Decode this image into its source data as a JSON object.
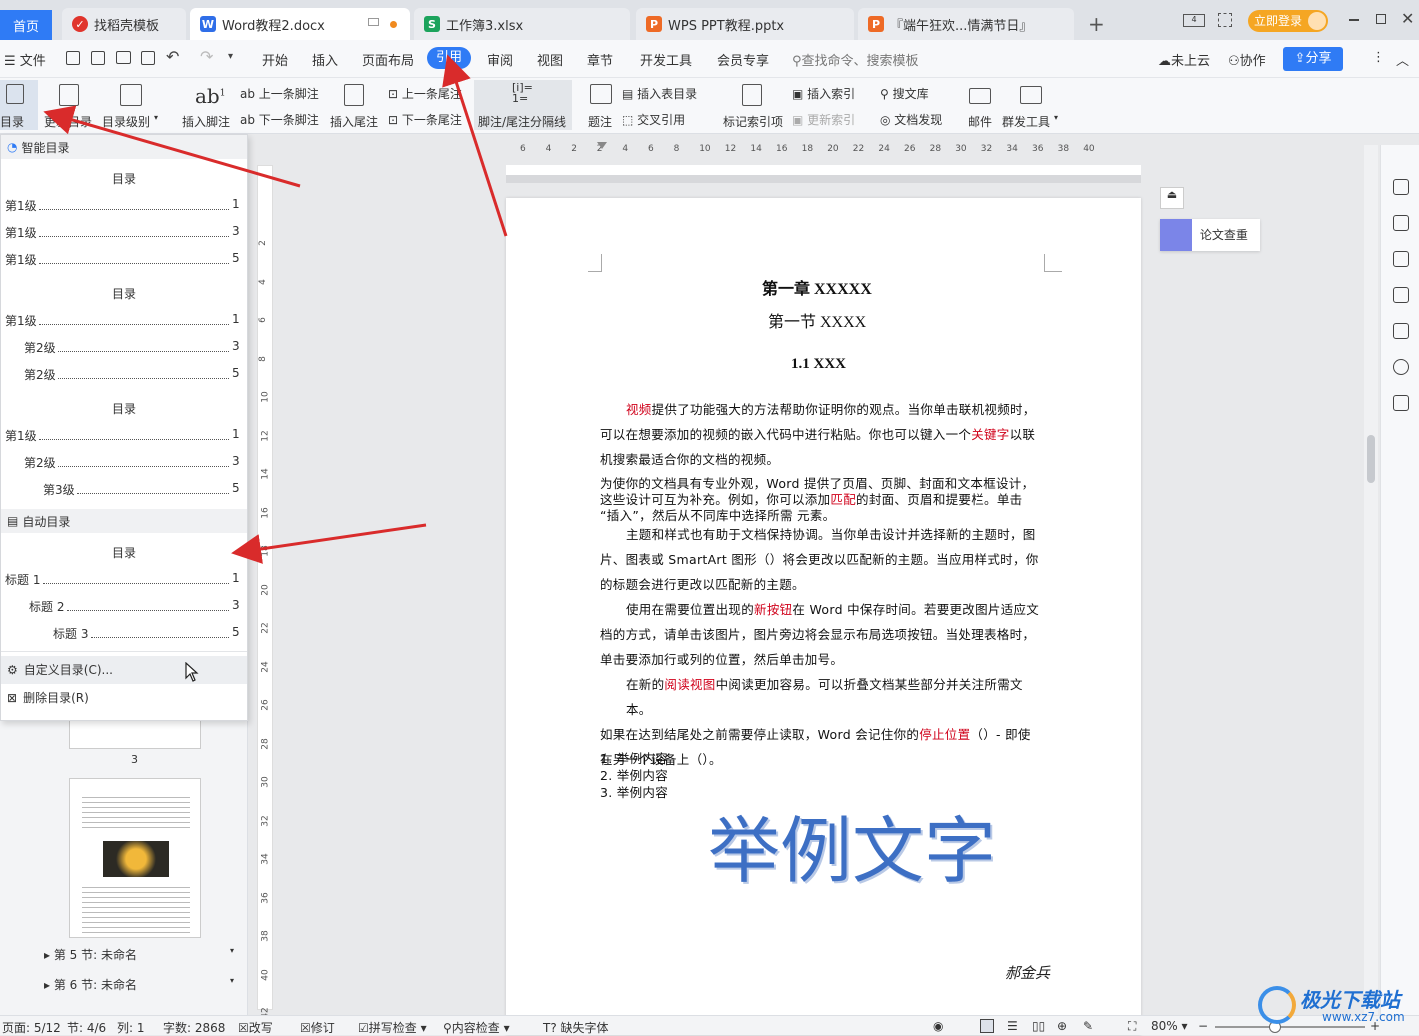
{
  "tabs": [
    {
      "label": "首页",
      "active": true
    },
    {
      "label": "找稻壳模板"
    },
    {
      "label": "Word教程2.docx",
      "current": true
    },
    {
      "label": "工作簿3.xlsx"
    },
    {
      "label": "WPS PPT教程.pptx"
    },
    {
      "label": "『端午狂欢...情满节日』"
    }
  ],
  "login_label": "立即登录",
  "menu": {
    "file": "文件",
    "items": [
      "开始",
      "插入",
      "页面布局",
      "引用",
      "审阅",
      "视图",
      "章节",
      "开发工具",
      "会员专享"
    ],
    "active": "引用",
    "search_placeholder": "查找命令、搜索模板",
    "cloud": "未上云",
    "collab": "协作",
    "share": "分享"
  },
  "ribbon": {
    "toc": "目录",
    "update_toc": "更新目录",
    "toc_level": "目录级别",
    "insert_footnote": "插入脚注",
    "prev_footnote": "上一条脚注",
    "next_footnote": "下一条脚注",
    "insert_endnote": "插入尾注",
    "prev_endnote": "上一条尾注",
    "next_endnote": "下一条尾注",
    "separator": "脚注/尾注分隔线",
    "caption": "题注",
    "insert_table_toc": "插入表目录",
    "cross_ref": "交叉引用",
    "mark_index": "标记索引项",
    "insert_index": "插入索引",
    "update_index": "更新索引",
    "search_lib": "搜文库",
    "doc_discover": "文档发现",
    "mail": "邮件",
    "mass_tool": "群发工具"
  },
  "toc_panel": {
    "smart_header": "智能目录",
    "auto_header": "自动目录",
    "toc_title": "目录",
    "group1": [
      {
        "label": "第1级",
        "page": "1"
      },
      {
        "label": "第1级",
        "page": "3"
      },
      {
        "label": "第1级",
        "page": "5"
      }
    ],
    "group2": [
      {
        "label": "第1级",
        "page": "1"
      },
      {
        "label": "第2级",
        "page": "3"
      },
      {
        "label": "第2级",
        "page": "5"
      }
    ],
    "group3": [
      {
        "label": "第1级",
        "page": "1"
      },
      {
        "label": "第2级",
        "page": "3"
      },
      {
        "label": "第3级",
        "page": "5"
      }
    ],
    "auto": [
      {
        "label": "标题 1",
        "page": "1"
      },
      {
        "label": "标题 2",
        "page": "3"
      },
      {
        "label": "标题 3",
        "page": "5"
      }
    ],
    "custom": "自定义目录(C)...",
    "delete": "删除目录(R)"
  },
  "nav": {
    "page_num": "3",
    "section5": "第 5 节: 未命名",
    "section6": "第 6 节: 未命名"
  },
  "ruler": [
    "6",
    "4",
    "2",
    "2",
    "4",
    "6",
    "8",
    "10",
    "12",
    "14",
    "16",
    "18",
    "20",
    "22",
    "24",
    "26",
    "28",
    "30",
    "32",
    "34",
    "36",
    "38",
    "40"
  ],
  "vruler": [
    "2",
    "4",
    "6",
    "8",
    "10",
    "12",
    "14",
    "16",
    "18",
    "20",
    "22",
    "24",
    "26",
    "28",
    "30",
    "32",
    "34",
    "36",
    "38",
    "40",
    "42"
  ],
  "doc": {
    "chapter": "第一章  XXXXX",
    "section": "第一节  XXXX",
    "sub": "1.1 XXX",
    "p1a_red": "视频",
    "p1a": "提供了功能强大的方法帮助你证明你的观点。当你单击联机视频时，",
    "p1b": "可以在想要添加的视频的嵌入代码中进行粘贴。你也可以键入一个",
    "p1b_red": "关键字",
    "p1b_end": "以联",
    "p1c": "机搜索最适合你的文档的视频。",
    "p2a": "为使你的文档具有专业外观，Word 提供了页眉、页脚、封面和文本框设计，",
    "p2b": "这些设计可互为补充。例如，你可以添加",
    "p2b_red": "匹配",
    "p2b_end": "的封面、页眉和提要栏。单击",
    "p2c": "“插入”，然后从不同库中选择所需 元素。",
    "p3a": "主题和样式也有助于文档保持协调。当你单击设计并选择新的主题时，图",
    "p3b": "片、图表或 SmartArt 图形（）将会更改以匹配新的主题。当应用样式时，你",
    "p3c": "的标题会进行更改以匹配新的主题。",
    "p4a": "使用在需要位置出现的",
    "p4a_red": "新按钮",
    "p4a_end": "在 Word 中保存时间。若要更改图片适应文",
    "p4b": "档的方式，请单击该图片，图片旁边将会显示布局选项按钮。当处理表格时，",
    "p4c": "单击要添加行或列的位置，然后单击加号。",
    "p5a": "在新的",
    "p5a_red": "阅读视图",
    "p5a_end": "中阅读更加容易。可以折叠文档某些部分并关注所需文本。",
    "p5b": "如果在达到结尾处之前需要停止读取，Word 会记住你的",
    "p5b_red": "停止位置",
    "p5b_end": "（）- 即使",
    "p5c": "在另一个设备上（）。",
    "list": [
      "1. 举例内容",
      "2. 举例内容",
      "3. 举例内容"
    ],
    "wordart": "举例文字",
    "signature": "郝金兵"
  },
  "side_panel": {
    "paper_check": "论文查重"
  },
  "status": {
    "page": "页面: 5/12",
    "section": "节: 4/6",
    "col": "列: 1",
    "words": "字数: 2868",
    "revise": "改写",
    "track": "修订",
    "spell": "拼写检查",
    "content_check": "内容检查",
    "missing_font": "缺失字体",
    "zoom": "80%"
  },
  "watermark": {
    "brand": "极光下载站",
    "url": "www.xz7.com"
  },
  "colors": {
    "accent": "#2f7bf5",
    "arrow": "#d92b2b",
    "wordart": "#3d6fc4"
  }
}
